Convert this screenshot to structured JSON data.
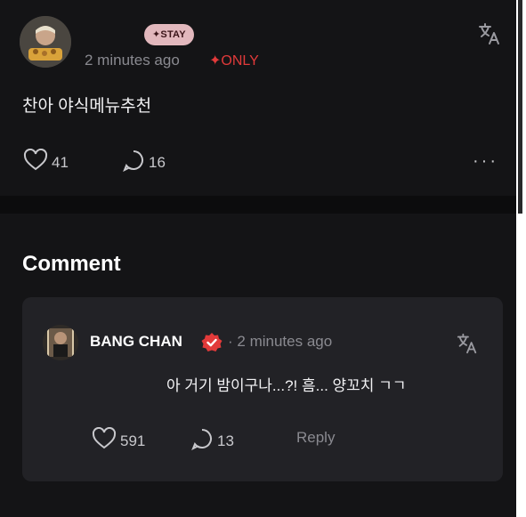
{
  "post": {
    "badge": "✦STAY",
    "time": "2 minutes ago",
    "only": "✦ONLY",
    "body": "찬아 야식메뉴추천",
    "likes": "41",
    "comments": "16",
    "more": "···"
  },
  "comment_section": {
    "heading": "Comment",
    "comment": {
      "author": "BANG CHAN",
      "separator": "·",
      "time": "2 minutes ago",
      "body": "아 거기 밤이구나...?! 흠... 양꼬치 ㄱㄱ",
      "likes": "591",
      "replies": "13",
      "reply_label": "Reply"
    }
  },
  "colors": {
    "background": "#141416",
    "card": "#222226",
    "accent_red": "#e23a3a",
    "badge_pink": "#e2b8bd",
    "muted": "#8a8a90"
  },
  "icons": [
    "translate-icon",
    "heart-icon",
    "speech-bubble-icon",
    "more-icon",
    "verified-badge-icon"
  ]
}
